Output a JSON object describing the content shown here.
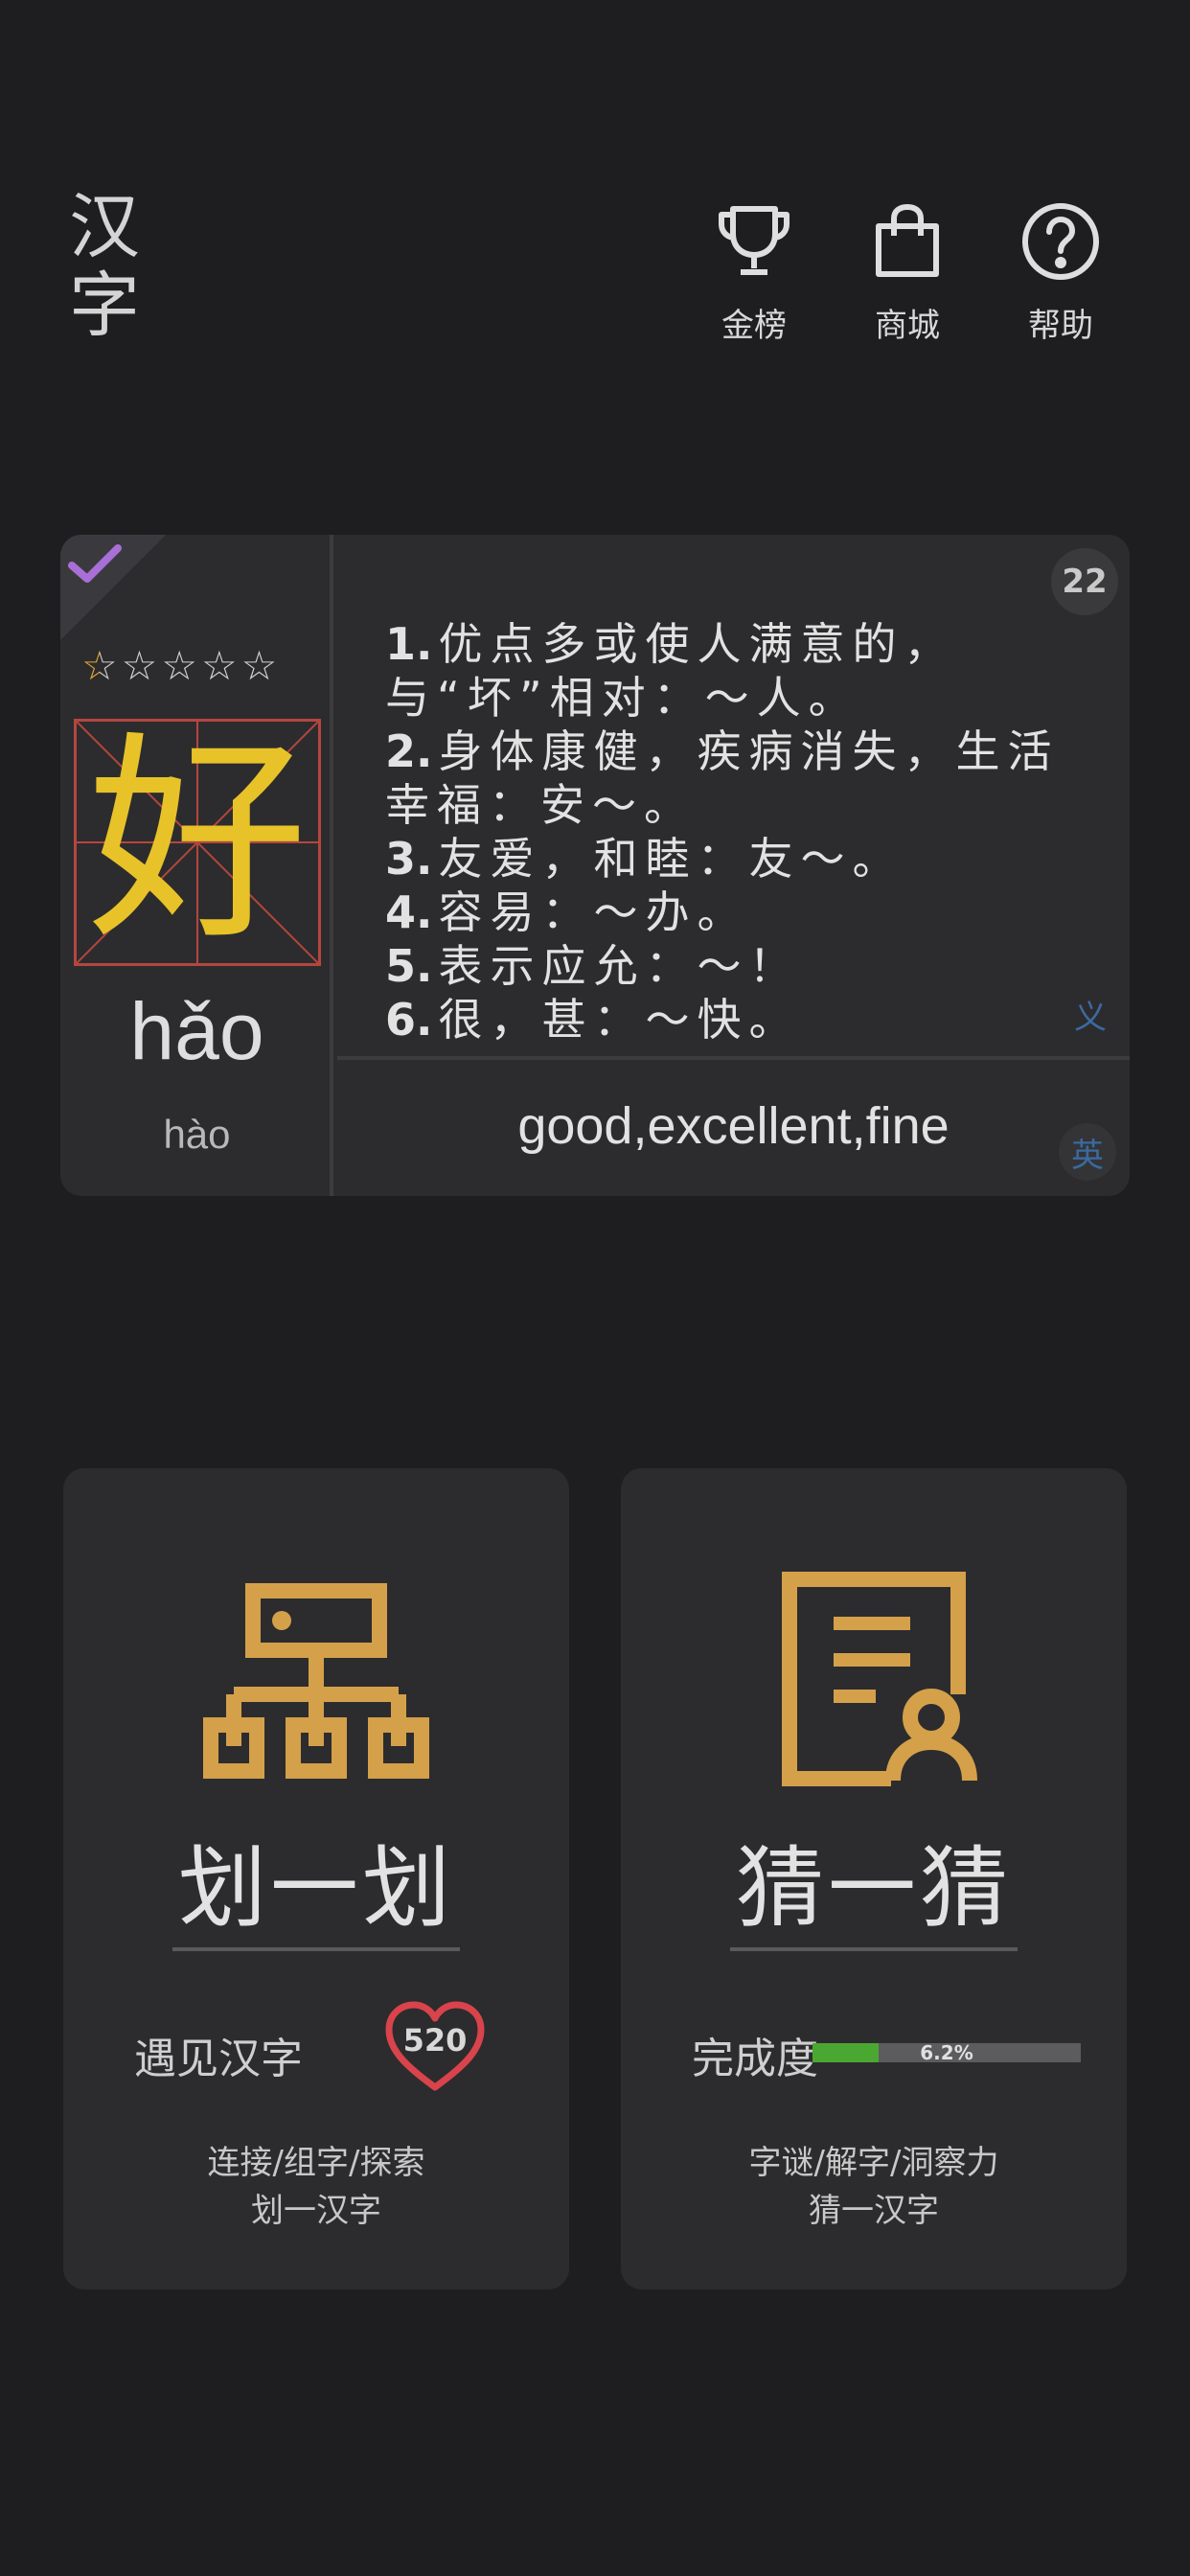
{
  "app": {
    "logo": "汉字"
  },
  "nav": [
    {
      "label": "金榜",
      "icon": "trophy-icon"
    },
    {
      "label": "商城",
      "icon": "shopping-bag-icon"
    },
    {
      "label": "帮助",
      "icon": "help-icon"
    }
  ],
  "character": {
    "char": "好",
    "pinyin": "hǎo",
    "pinyin_alt": "hào",
    "count": "22",
    "rating": 0.5,
    "rating_max": 5,
    "definitions": [
      {
        "num": "1.",
        "text": "优点多或使人满意的，与“坏”相对：～人。"
      },
      {
        "num": "2.",
        "text": "身体康健，疾病消失，生活幸福：安～。"
      },
      {
        "num": "3.",
        "text": "友爱，和睦：友～。"
      },
      {
        "num": "4.",
        "text": "容易：～办。"
      },
      {
        "num": "5.",
        "text": "表示应允：～！"
      },
      {
        "num": "6.",
        "text": "很，甚：～快。"
      }
    ],
    "meaning_tag": "义",
    "english": "good,excellent,fine",
    "english_tag": "英",
    "colors": {
      "char": "#e8c229",
      "grid": "#b4463f",
      "check": "#a86fd6"
    }
  },
  "modes": {
    "stroke": {
      "title": "划一划",
      "stat_label": "遇见汉字",
      "heart_value": "520",
      "desc_line1": "连接/组字/探索",
      "desc_line2": "划一汉字"
    },
    "guess": {
      "title": "猜一猜",
      "stat_label": "完成度",
      "progress": 0.062,
      "progress_label": "6.2%",
      "desc_line1": "字谜/解字/洞察力",
      "desc_line2": "猜一汉字"
    },
    "accent": "#d4a04a"
  }
}
